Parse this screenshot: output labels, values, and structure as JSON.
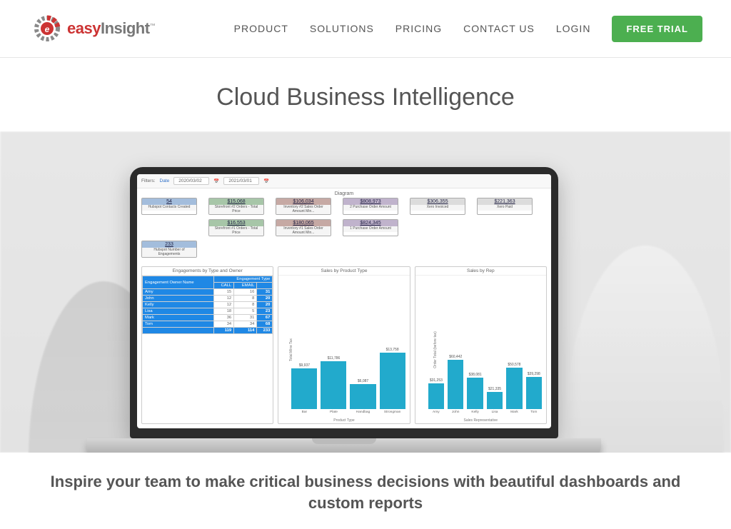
{
  "nav": {
    "links": [
      "PRODUCT",
      "SOLUTIONS",
      "PRICING",
      "CONTACT US",
      "LOGIN"
    ],
    "cta": "FREE TRIAL"
  },
  "hero_title": "Cloud Business Intelligence",
  "subheadline": "Inspire your team to make critical business decisions with beautiful dashboards and custom reports",
  "dashboard": {
    "filters": {
      "label": "Filters:",
      "field": "Date",
      "from": "2020/03/02",
      "to": "2021/03/01"
    },
    "diagram_title": "Diagram",
    "nodes": {
      "r1": [
        {
          "cls": "n-blue",
          "val": "54",
          "lab": "Hubspot Contacts Created"
        },
        {
          "cls": "n-green",
          "val": "$15,068",
          "lab": "Storefront #2 Orders - Total Price"
        },
        {
          "cls": "n-brown",
          "val": "$106,034",
          "lab": "Inventory #2 Sales Order Amount Min..."
        },
        {
          "cls": "n-purple",
          "val": "$808,973",
          "lab": "2 Purchase Order Amount"
        },
        {
          "cls": "n-grey",
          "val": "$306,355",
          "lab": "Xero Invoiced"
        },
        {
          "cls": "n-grey",
          "val": "$221,363",
          "lab": "Xero Paid"
        }
      ],
      "r2": [
        {
          "cls": "n-green",
          "val": "$16,553",
          "lab": "Storefront #1 Orders - Total Price"
        },
        {
          "cls": "n-brown",
          "val": "$180,065",
          "lab": "Inventory #1 Sales Order Amount Min..."
        },
        {
          "cls": "n-purple",
          "val": "$824,345",
          "lab": "1 Purchase Order Amount"
        }
      ],
      "r3": [
        {
          "cls": "n-blue",
          "val": "233",
          "lab": "Hubspot Number of Engagements"
        }
      ]
    },
    "engagement_table": {
      "title": "Engagements by Type and Owner",
      "group_header": "Engagement Type",
      "corner": "Engagement Owner Name",
      "cols": [
        "CALL",
        "EMAIL"
      ],
      "rows": [
        {
          "name": "Amy",
          "vals": [
            "15",
            "16"
          ],
          "tot": "31"
        },
        {
          "name": "John",
          "vals": [
            "12",
            "8"
          ],
          "tot": "20"
        },
        {
          "name": "Kelly",
          "vals": [
            "12",
            "8"
          ],
          "tot": "20"
        },
        {
          "name": "Lisa",
          "vals": [
            "18",
            "5"
          ],
          "tot": "23"
        },
        {
          "name": "Mark",
          "vals": [
            "36",
            "31"
          ],
          "tot": "67"
        },
        {
          "name": "Tom",
          "vals": [
            "34",
            "34"
          ],
          "tot": "68"
        }
      ],
      "totals": [
        "119",
        "114",
        "233"
      ]
    }
  },
  "chart_data": [
    {
      "type": "bar",
      "title": "Sales by Product Type",
      "xlabel": "Product Type",
      "ylabel": "Total Mine Tax",
      "ylim": [
        0,
        14000
      ],
      "categories": [
        "Bar",
        "Plate",
        "Handbag",
        "Strongman"
      ],
      "values": [
        9937,
        11786,
        6087,
        13758
      ],
      "value_labels": [
        "$9,937",
        "$11,786",
        "$6,087",
        "$13,758"
      ]
    },
    {
      "type": "bar",
      "title": "Sales by Rep",
      "xlabel": "Sales Representative",
      "ylabel": "Order Total (before tax)",
      "ylim": [
        0,
        70000
      ],
      "categories": [
        "Amy",
        "John",
        "Kelly",
        "Lisa",
        "Mark",
        "Tom"
      ],
      "values": [
        31253,
        60442,
        38081,
        21335,
        50578,
        39298
      ],
      "value_labels": [
        "$31,253",
        "$60,442",
        "$38,081",
        "$21,335",
        "$50,578",
        "$39,298"
      ]
    }
  ]
}
